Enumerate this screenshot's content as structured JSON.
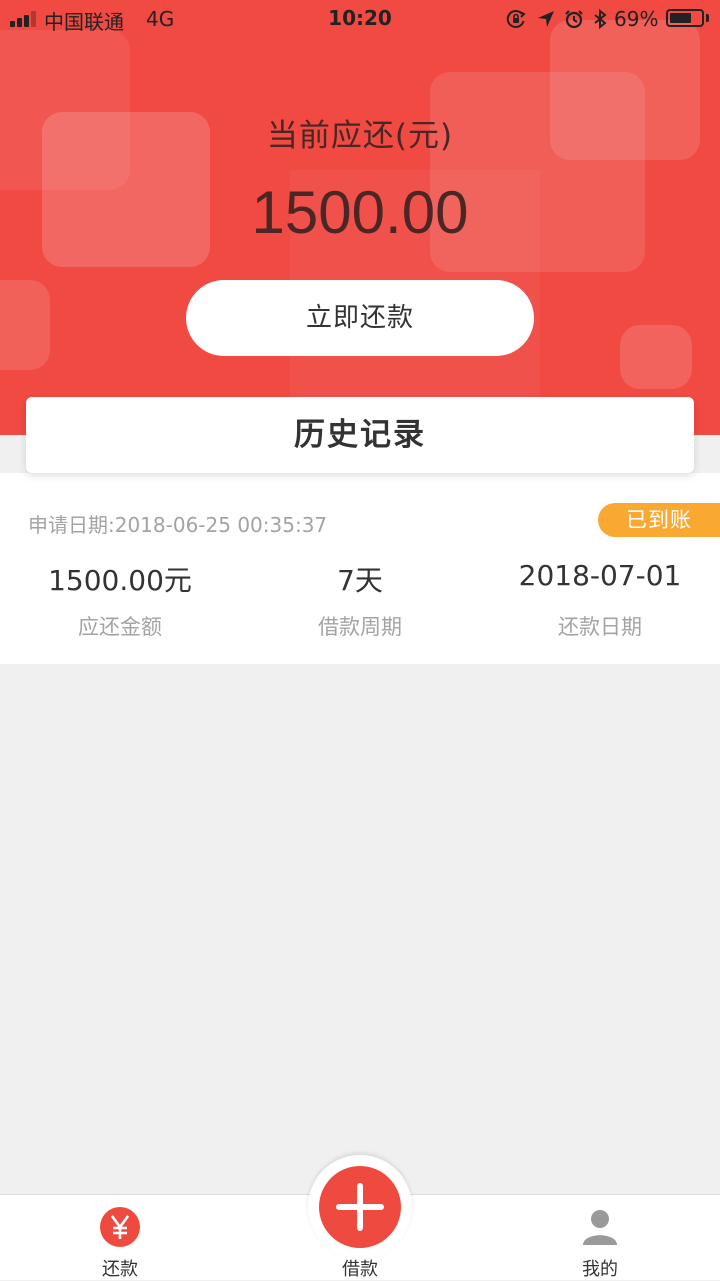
{
  "status_bar": {
    "carrier": "中国联通",
    "network": "4G",
    "time": "10:20",
    "battery_percent": "69%",
    "battery_level": 0.69,
    "signal_bars_filled": 3,
    "icons": [
      "orientation-lock-icon",
      "location-arrow-icon",
      "alarm-icon",
      "bluetooth-icon"
    ]
  },
  "hero": {
    "label": "当前应还(元)",
    "amount": "1500.00",
    "repay_button": "立即还款",
    "background_color": "#f04a43"
  },
  "history": {
    "title": "历史记录",
    "records": [
      {
        "apply_date": "申请日期:2018-06-25 00:35:37",
        "status": "已到账",
        "amount": "1500.00元",
        "amount_label": "应还金额",
        "period": "7天",
        "period_label": "借款周期",
        "due_date": "2018-07-01",
        "due_date_label": "还款日期"
      }
    ]
  },
  "tabbar": {
    "tabs": [
      {
        "label": "还款",
        "icon": "yen-icon",
        "active": true
      },
      {
        "label": "借款",
        "icon": "plus-icon",
        "active": false
      },
      {
        "label": "我的",
        "icon": "user-icon",
        "active": false
      }
    ]
  },
  "colors": {
    "accent_red": "#f04a43",
    "badge_orange": "#f9a832",
    "page_background": "#f0f0f0"
  }
}
